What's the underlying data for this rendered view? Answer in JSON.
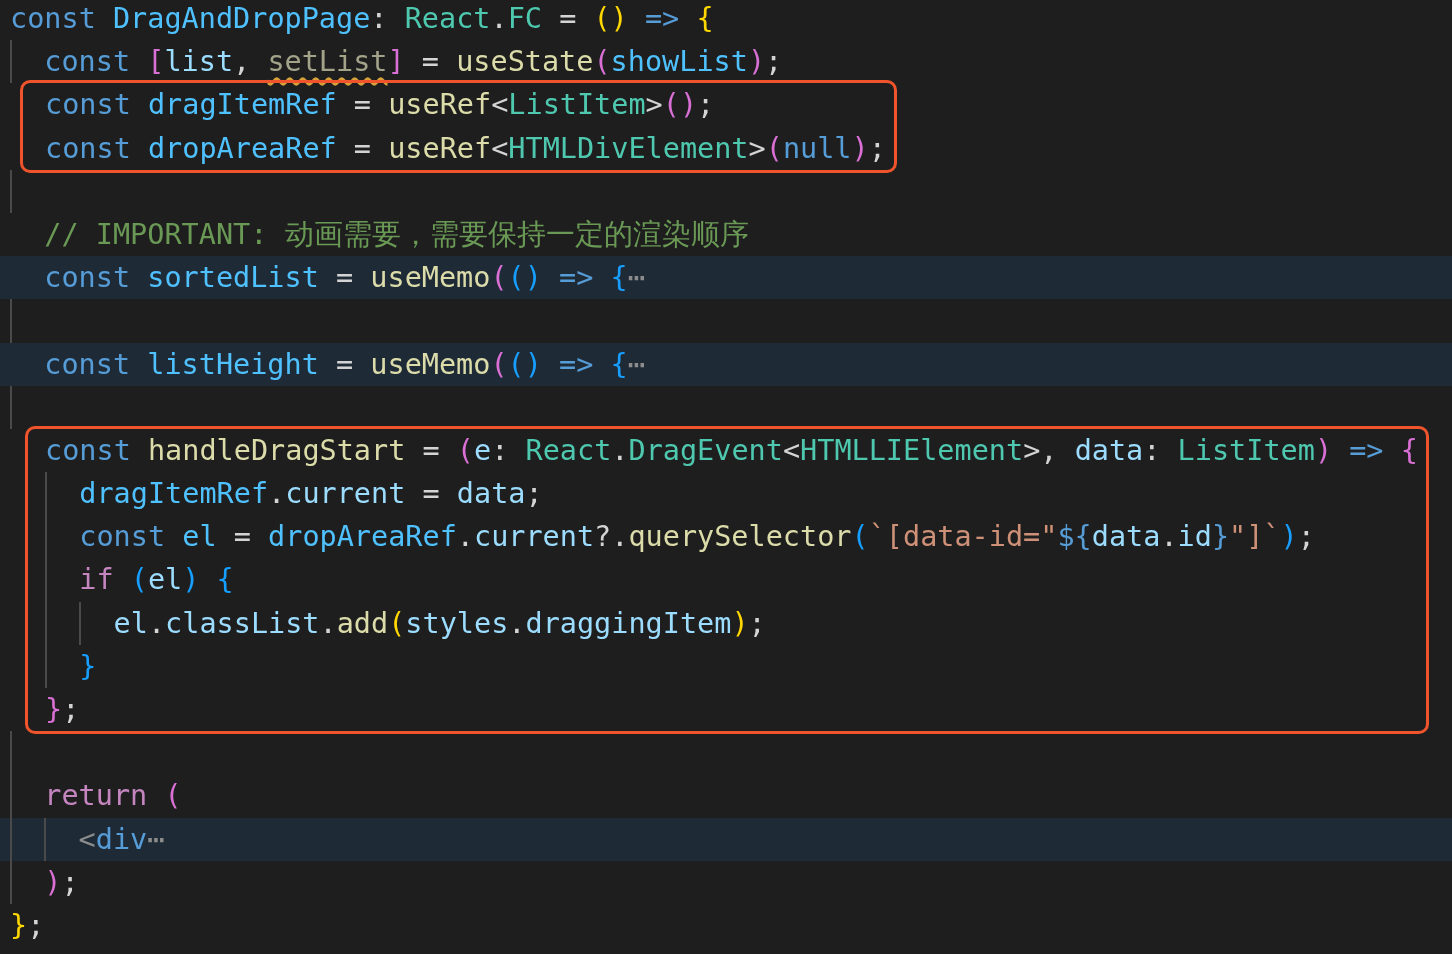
{
  "editor": {
    "blocks": [
      {
        "kind": "plain",
        "lines": [
          {
            "folded": false,
            "tokens": [
              {
                "text": "const ",
                "color": "#569cd6"
              },
              {
                "text": "DragAndDropPage",
                "color": "#4fc1ff"
              },
              {
                "text": ": ",
                "color": "#d4d4d4"
              },
              {
                "text": "React",
                "color": "#4ec9b0"
              },
              {
                "text": ".",
                "color": "#d4d4d4"
              },
              {
                "text": "FC",
                "color": "#4ec9b0"
              },
              {
                "text": " = ",
                "color": "#d4d4d4"
              },
              {
                "text": "()",
                "color": "#ffd700"
              },
              {
                "text": " => ",
                "color": "#569cd6"
              },
              {
                "text": "{",
                "color": "#ffd700"
              }
            ]
          },
          {
            "guides": [
              {
                "visible": true
              }
            ],
            "folded": false,
            "tokens": [
              {
                "text": "const ",
                "color": "#569cd6"
              },
              {
                "text": "[",
                "color": "#da70d6"
              },
              {
                "text": "list",
                "color": "#9cdcfe"
              },
              {
                "text": ", ",
                "color": "#d4d4d4"
              },
              {
                "text": "setList",
                "color": "#a3a38a",
                "warning": true
              },
              {
                "text": "]",
                "color": "#da70d6"
              },
              {
                "text": " = ",
                "color": "#d4d4d4"
              },
              {
                "text": "useState",
                "color": "#dcdcaa"
              },
              {
                "text": "(",
                "color": "#da70d6"
              },
              {
                "text": "showList",
                "color": "#4fc1ff"
              },
              {
                "text": ")",
                "color": "#da70d6"
              },
              {
                "text": ";",
                "color": "#d4d4d4"
              }
            ]
          }
        ]
      },
      {
        "kind": "highlight",
        "lines": [
          {
            "guides": [
              {
                "visible": false
              }
            ],
            "folded": false,
            "tokens": [
              {
                "text": "const ",
                "color": "#569cd6"
              },
              {
                "text": "dragItemRef",
                "color": "#4fc1ff"
              },
              {
                "text": " = ",
                "color": "#d4d4d4"
              },
              {
                "text": "useRef",
                "color": "#dcdcaa"
              },
              {
                "text": "<",
                "color": "#d4d4d4"
              },
              {
                "text": "ListItem",
                "color": "#4ec9b0"
              },
              {
                "text": ">",
                "color": "#d4d4d4"
              },
              {
                "text": "()",
                "color": "#da70d6"
              },
              {
                "text": ";",
                "color": "#d4d4d4"
              }
            ]
          },
          {
            "guides": [
              {
                "visible": false
              }
            ],
            "folded": false,
            "tokens": [
              {
                "text": "const ",
                "color": "#569cd6"
              },
              {
                "text": "dropAreaRef",
                "color": "#4fc1ff"
              },
              {
                "text": " = ",
                "color": "#d4d4d4"
              },
              {
                "text": "useRef",
                "color": "#dcdcaa"
              },
              {
                "text": "<",
                "color": "#d4d4d4"
              },
              {
                "text": "HTMLDivElement",
                "color": "#4ec9b0"
              },
              {
                "text": ">",
                "color": "#d4d4d4"
              },
              {
                "text": "(",
                "color": "#da70d6"
              },
              {
                "text": "null",
                "color": "#569cd6"
              },
              {
                "text": ")",
                "color": "#da70d6"
              },
              {
                "text": ";",
                "color": "#d4d4d4"
              }
            ]
          }
        ]
      },
      {
        "kind": "plain",
        "lines": [
          {
            "guides": [
              {
                "visible": true
              }
            ],
            "folded": false
          },
          {
            "guides": [
              {
                "visible": false
              }
            ],
            "folded": false,
            "tokens": [
              {
                "text": "// IMPORTANT: 动画需要，需要保持一定的渲染顺序",
                "color": "#6a9955"
              }
            ]
          },
          {
            "guides": [
              {
                "visible": false
              }
            ],
            "folded": true,
            "tokens": [
              {
                "text": "const ",
                "color": "#569cd6"
              },
              {
                "text": "sortedList",
                "color": "#4fc1ff"
              },
              {
                "text": " = ",
                "color": "#d4d4d4"
              },
              {
                "text": "useMemo",
                "color": "#dcdcaa"
              },
              {
                "text": "(",
                "color": "#da70d6"
              },
              {
                "text": "()",
                "color": "#179fff"
              },
              {
                "text": " => ",
                "color": "#569cd6"
              },
              {
                "text": "{",
                "color": "#179fff"
              },
              {
                "text": "⋯",
                "color": "#8c8c8c"
              }
            ]
          },
          {
            "guides": [
              {
                "visible": true
              }
            ],
            "folded": false
          },
          {
            "guides": [
              {
                "visible": false
              }
            ],
            "folded": true,
            "tokens": [
              {
                "text": "const ",
                "color": "#569cd6"
              },
              {
                "text": "listHeight",
                "color": "#4fc1ff"
              },
              {
                "text": " = ",
                "color": "#d4d4d4"
              },
              {
                "text": "useMemo",
                "color": "#dcdcaa"
              },
              {
                "text": "(",
                "color": "#da70d6"
              },
              {
                "text": "()",
                "color": "#179fff"
              },
              {
                "text": " => ",
                "color": "#569cd6"
              },
              {
                "text": "{",
                "color": "#179fff"
              },
              {
                "text": "⋯",
                "color": "#8c8c8c"
              }
            ]
          },
          {
            "guides": [
              {
                "visible": true
              }
            ],
            "folded": false
          }
        ]
      },
      {
        "kind": "highlight",
        "lines": [
          {
            "guides": [
              {
                "visible": false
              }
            ],
            "folded": false,
            "tokens": [
              {
                "text": "const ",
                "color": "#569cd6"
              },
              {
                "text": "handleDragStart",
                "color": "#dcdcaa"
              },
              {
                "text": " = ",
                "color": "#d4d4d4"
              },
              {
                "text": "(",
                "color": "#da70d6"
              },
              {
                "text": "e",
                "color": "#9cdcfe"
              },
              {
                "text": ": ",
                "color": "#d4d4d4"
              },
              {
                "text": "React",
                "color": "#4ec9b0"
              },
              {
                "text": ".",
                "color": "#d4d4d4"
              },
              {
                "text": "DragEvent",
                "color": "#4ec9b0"
              },
              {
                "text": "<",
                "color": "#d4d4d4"
              },
              {
                "text": "HTMLLIElement",
                "color": "#4ec9b0"
              },
              {
                "text": ">, ",
                "color": "#d4d4d4"
              },
              {
                "text": "data",
                "color": "#9cdcfe"
              },
              {
                "text": ": ",
                "color": "#d4d4d4"
              },
              {
                "text": "ListItem",
                "color": "#4ec9b0"
              },
              {
                "text": ")",
                "color": "#da70d6"
              },
              {
                "text": " => ",
                "color": "#569cd6"
              },
              {
                "text": "{",
                "color": "#da70d6"
              }
            ]
          },
          {
            "guides": [
              {
                "visible": false
              },
              {
                "visible": true
              }
            ],
            "folded": false,
            "tokens": [
              {
                "text": "dragItemRef",
                "color": "#4fc1ff"
              },
              {
                "text": ".",
                "color": "#d4d4d4"
              },
              {
                "text": "current",
                "color": "#9cdcfe"
              },
              {
                "text": " = ",
                "color": "#d4d4d4"
              },
              {
                "text": "data",
                "color": "#9cdcfe"
              },
              {
                "text": ";",
                "color": "#d4d4d4"
              }
            ]
          },
          {
            "guides": [
              {
                "visible": false
              },
              {
                "visible": true
              }
            ],
            "folded": false,
            "tokens": [
              {
                "text": "const ",
                "color": "#569cd6"
              },
              {
                "text": "el",
                "color": "#4fc1ff"
              },
              {
                "text": " = ",
                "color": "#d4d4d4"
              },
              {
                "text": "dropAreaRef",
                "color": "#4fc1ff"
              },
              {
                "text": ".",
                "color": "#d4d4d4"
              },
              {
                "text": "current",
                "color": "#9cdcfe"
              },
              {
                "text": "?.",
                "color": "#d4d4d4"
              },
              {
                "text": "querySelector",
                "color": "#dcdcaa"
              },
              {
                "text": "(",
                "color": "#179fff"
              },
              {
                "text": "`[data-id=\"",
                "color": "#ce9178"
              },
              {
                "text": "${",
                "color": "#569cd6"
              },
              {
                "text": "data",
                "color": "#9cdcfe"
              },
              {
                "text": ".",
                "color": "#d4d4d4"
              },
              {
                "text": "id",
                "color": "#9cdcfe"
              },
              {
                "text": "}",
                "color": "#569cd6"
              },
              {
                "text": "\"]`",
                "color": "#ce9178"
              },
              {
                "text": ")",
                "color": "#179fff"
              },
              {
                "text": ";",
                "color": "#d4d4d4"
              }
            ]
          },
          {
            "guides": [
              {
                "visible": false
              },
              {
                "visible": true
              }
            ],
            "folded": false,
            "tokens": [
              {
                "text": "if ",
                "color": "#c586c0"
              },
              {
                "text": "(",
                "color": "#179fff"
              },
              {
                "text": "el",
                "color": "#9cdcfe"
              },
              {
                "text": ") ",
                "color": "#179fff"
              },
              {
                "text": "{",
                "color": "#179fff"
              }
            ]
          },
          {
            "guides": [
              {
                "visible": false
              },
              {
                "visible": true
              },
              {
                "visible": true
              }
            ],
            "folded": false,
            "tokens": [
              {
                "text": "el",
                "color": "#9cdcfe"
              },
              {
                "text": ".",
                "color": "#d4d4d4"
              },
              {
                "text": "classList",
                "color": "#9cdcfe"
              },
              {
                "text": ".",
                "color": "#d4d4d4"
              },
              {
                "text": "add",
                "color": "#dcdcaa"
              },
              {
                "text": "(",
                "color": "#ffd700"
              },
              {
                "text": "styles",
                "color": "#9cdcfe"
              },
              {
                "text": ".",
                "color": "#d4d4d4"
              },
              {
                "text": "draggingItem",
                "color": "#9cdcfe"
              },
              {
                "text": ")",
                "color": "#ffd700"
              },
              {
                "text": ";",
                "color": "#d4d4d4"
              }
            ]
          },
          {
            "guides": [
              {
                "visible": false
              },
              {
                "visible": true
              }
            ],
            "folded": false,
            "tokens": [
              {
                "text": "}",
                "color": "#179fff"
              }
            ]
          },
          {
            "guides": [
              {
                "visible": false
              }
            ],
            "folded": false,
            "tokens": [
              {
                "text": "}",
                "color": "#da70d6"
              },
              {
                "text": ";",
                "color": "#d4d4d4"
              }
            ]
          }
        ]
      },
      {
        "kind": "plain",
        "lines": [
          {
            "guides": [
              {
                "visible": true
              }
            ],
            "folded": false
          },
          {
            "guides": [
              {
                "visible": true
              }
            ],
            "folded": false,
            "tokens": [
              {
                "text": "return ",
                "color": "#c586c0"
              },
              {
                "text": "(",
                "color": "#da70d6"
              }
            ]
          },
          {
            "guides": [
              {
                "visible": true
              },
              {
                "visible": true
              }
            ],
            "folded": true,
            "tokens": [
              {
                "text": "<",
                "color": "#8c8c8c"
              },
              {
                "text": "div",
                "color": "#569cd6"
              },
              {
                "text": "⋯",
                "color": "#8c8c8c"
              }
            ]
          },
          {
            "guides": [
              {
                "visible": true
              }
            ],
            "folded": false,
            "tokens": [
              {
                "text": ")",
                "color": "#da70d6"
              },
              {
                "text": ";",
                "color": "#d4d4d4"
              }
            ]
          },
          {
            "folded": false,
            "tokens": [
              {
                "text": "}",
                "color": "#ffd700"
              },
              {
                "text": ";",
                "color": "#d4d4d4"
              }
            ]
          }
        ]
      }
    ]
  }
}
